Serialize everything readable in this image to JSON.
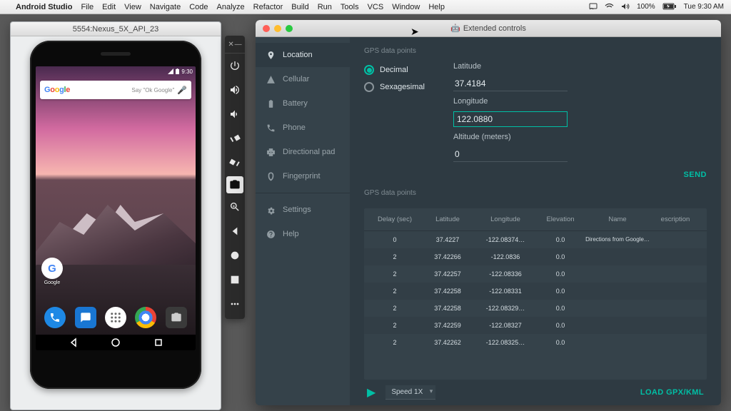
{
  "mac_menu": {
    "app": "Android Studio",
    "items": [
      "File",
      "Edit",
      "View",
      "Navigate",
      "Code",
      "Analyze",
      "Refactor",
      "Build",
      "Run",
      "Tools",
      "VCS",
      "Window",
      "Help"
    ],
    "battery": "100%",
    "clock": "Tue 9:30 AM"
  },
  "emu": {
    "title": "5554:Nexus_5X_API_23",
    "clock": "9:30",
    "google": "Google",
    "search_placeholder": "Say \"Ok Google\"",
    "google_app_label": "Google"
  },
  "ext": {
    "title": "Extended controls",
    "sidebar": [
      {
        "icon": "location",
        "label": "Location",
        "active": true
      },
      {
        "icon": "cellular",
        "label": "Cellular"
      },
      {
        "icon": "battery",
        "label": "Battery"
      },
      {
        "icon": "phone",
        "label": "Phone"
      },
      {
        "icon": "dpad",
        "label": "Directional pad"
      },
      {
        "icon": "finger",
        "label": "Fingerprint"
      },
      {
        "divider": true
      },
      {
        "icon": "settings",
        "label": "Settings"
      },
      {
        "icon": "help",
        "label": "Help"
      }
    ],
    "section_label": "GPS data points",
    "radios": {
      "decimal": "Decimal",
      "sexagesimal": "Sexagesimal",
      "selected": "decimal"
    },
    "fields": {
      "lat_label": "Latitude",
      "lat_value": "37.4184",
      "lon_label": "Longitude",
      "lon_value": "122.0880",
      "alt_label": "Altitude (meters)",
      "alt_value": "0"
    },
    "send": "SEND",
    "table": {
      "headers": {
        "delay": "Delay (sec)",
        "lat": "Latitude",
        "lon": "Longitude",
        "elev": "Elevation",
        "name": "Name",
        "desc": "escription"
      },
      "rows": [
        {
          "delay": "0",
          "lat": "37.4227",
          "lon": "-122.08374…",
          "elev": "0.0",
          "name": "Directions from Google…",
          "desc": ""
        },
        {
          "delay": "2",
          "lat": "37.42266",
          "lon": "-122.0836",
          "elev": "0.0",
          "name": "",
          "desc": ""
        },
        {
          "delay": "2",
          "lat": "37.42257",
          "lon": "-122.08336",
          "elev": "0.0",
          "name": "",
          "desc": ""
        },
        {
          "delay": "2",
          "lat": "37.42258",
          "lon": "-122.08331",
          "elev": "0.0",
          "name": "",
          "desc": ""
        },
        {
          "delay": "2",
          "lat": "37.42258",
          "lon": "-122.08329…",
          "elev": "0.0",
          "name": "",
          "desc": ""
        },
        {
          "delay": "2",
          "lat": "37.42259",
          "lon": "-122.08327",
          "elev": "0.0",
          "name": "",
          "desc": ""
        },
        {
          "delay": "2",
          "lat": "37.42262",
          "lon": "-122.08325…",
          "elev": "0.0",
          "name": "",
          "desc": ""
        }
      ]
    },
    "speed": "Speed 1X",
    "load": "LOAD GPX/KML"
  }
}
